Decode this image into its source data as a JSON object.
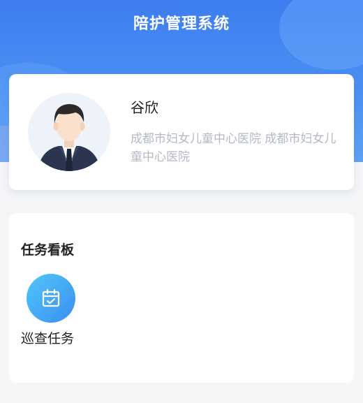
{
  "header": {
    "title": "陪护管理系统"
  },
  "profile": {
    "name": "谷欣",
    "hospital": "成都市妇女儿童中心医院 成都市妇女儿童中心医院"
  },
  "task_board": {
    "title": "任务看板",
    "items": [
      {
        "label": "巡查任务",
        "icon": "calendar-check-icon"
      }
    ]
  },
  "colors": {
    "header_gradient_top": "#3d7df0",
    "header_gradient_bottom": "#5ea2f5",
    "icon_gradient_start": "#52c6f8",
    "icon_gradient_end": "#3a8ff0",
    "muted_text": "#b3b9c4"
  }
}
